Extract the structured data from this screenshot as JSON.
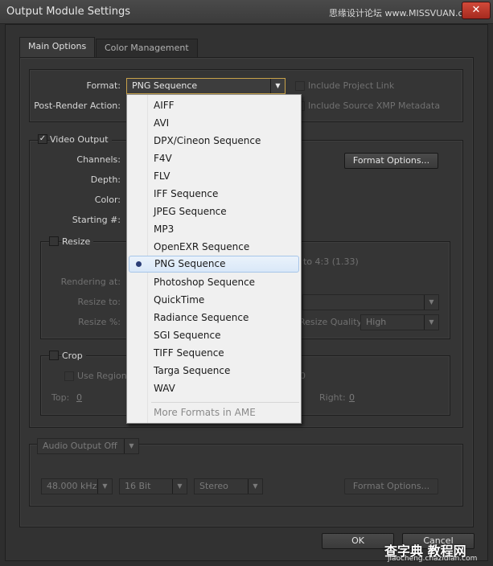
{
  "window": {
    "title": "Output Module Settings",
    "close_glyph": "✕",
    "watermark": "思缘设计论坛 www.MISSVUAN.com"
  },
  "tabs": [
    {
      "label": "Main Options",
      "active": true
    },
    {
      "label": "Color Management",
      "active": false
    }
  ],
  "format_section": {
    "format_label": "Format:",
    "format_value": "PNG Sequence",
    "post_render_label": "Post-Render Action:",
    "include_project_link": "Include Project Link",
    "include_xmp": "Include Source XMP Metadata"
  },
  "video": {
    "video_output_label": "Video Output",
    "video_output_checked": true,
    "channels_label": "Channels:",
    "depth_label": "Depth:",
    "color_label": "Color:",
    "starting_label": "Starting #:",
    "format_options_button": "Format Options...",
    "resize_label": "Resize",
    "resize_ratio_text": "to 4:3 (1.33)",
    "rendering_at_label": "Rendering at:",
    "resize_to_label": "Resize to:",
    "resize_pct_label": "Resize %:",
    "resize_quality_label": "Resize Quality:",
    "resize_quality_value": "High",
    "crop_label": "Crop",
    "use_region_label": "Use Region",
    "crop_fragment_value": "0",
    "top_label": "Top:",
    "top_value": "0",
    "right_label": "Right:",
    "right_value": "0"
  },
  "audio": {
    "audio_output_value": "Audio Output Off",
    "sample_rate": "48.000 kHz",
    "bit_depth": "16 Bit",
    "channels": "Stereo",
    "format_options_button": "Format Options..."
  },
  "footer": {
    "ok_button": "OK",
    "cancel_button": "Cancel",
    "watermark_main": "查字典 教程网",
    "watermark_sub": "jiaocheng.chazidian.com"
  },
  "format_dropdown": {
    "items": [
      {
        "label": "AIFF",
        "selected": false
      },
      {
        "label": "AVI",
        "selected": false
      },
      {
        "label": "DPX/Cineon Sequence",
        "selected": false
      },
      {
        "label": "F4V",
        "selected": false
      },
      {
        "label": "FLV",
        "selected": false
      },
      {
        "label": "IFF Sequence",
        "selected": false
      },
      {
        "label": "JPEG Sequence",
        "selected": false
      },
      {
        "label": "MP3",
        "selected": false
      },
      {
        "label": "OpenEXR Sequence",
        "selected": false
      },
      {
        "label": "PNG Sequence",
        "selected": true
      },
      {
        "label": "Photoshop Sequence",
        "selected": false
      },
      {
        "label": "QuickTime",
        "selected": false
      },
      {
        "label": "Radiance Sequence",
        "selected": false
      },
      {
        "label": "SGI Sequence",
        "selected": false
      },
      {
        "label": "TIFF Sequence",
        "selected": false
      },
      {
        "label": "Targa Sequence",
        "selected": false
      },
      {
        "label": "WAV",
        "selected": false
      }
    ],
    "more_label": "More Formats in AME"
  },
  "colors": {
    "dialog_bg": "#323232",
    "accent_focus": "#c8a24a",
    "menu_bg": "#f0f0f0",
    "menu_highlight": "#d9e8f8"
  }
}
